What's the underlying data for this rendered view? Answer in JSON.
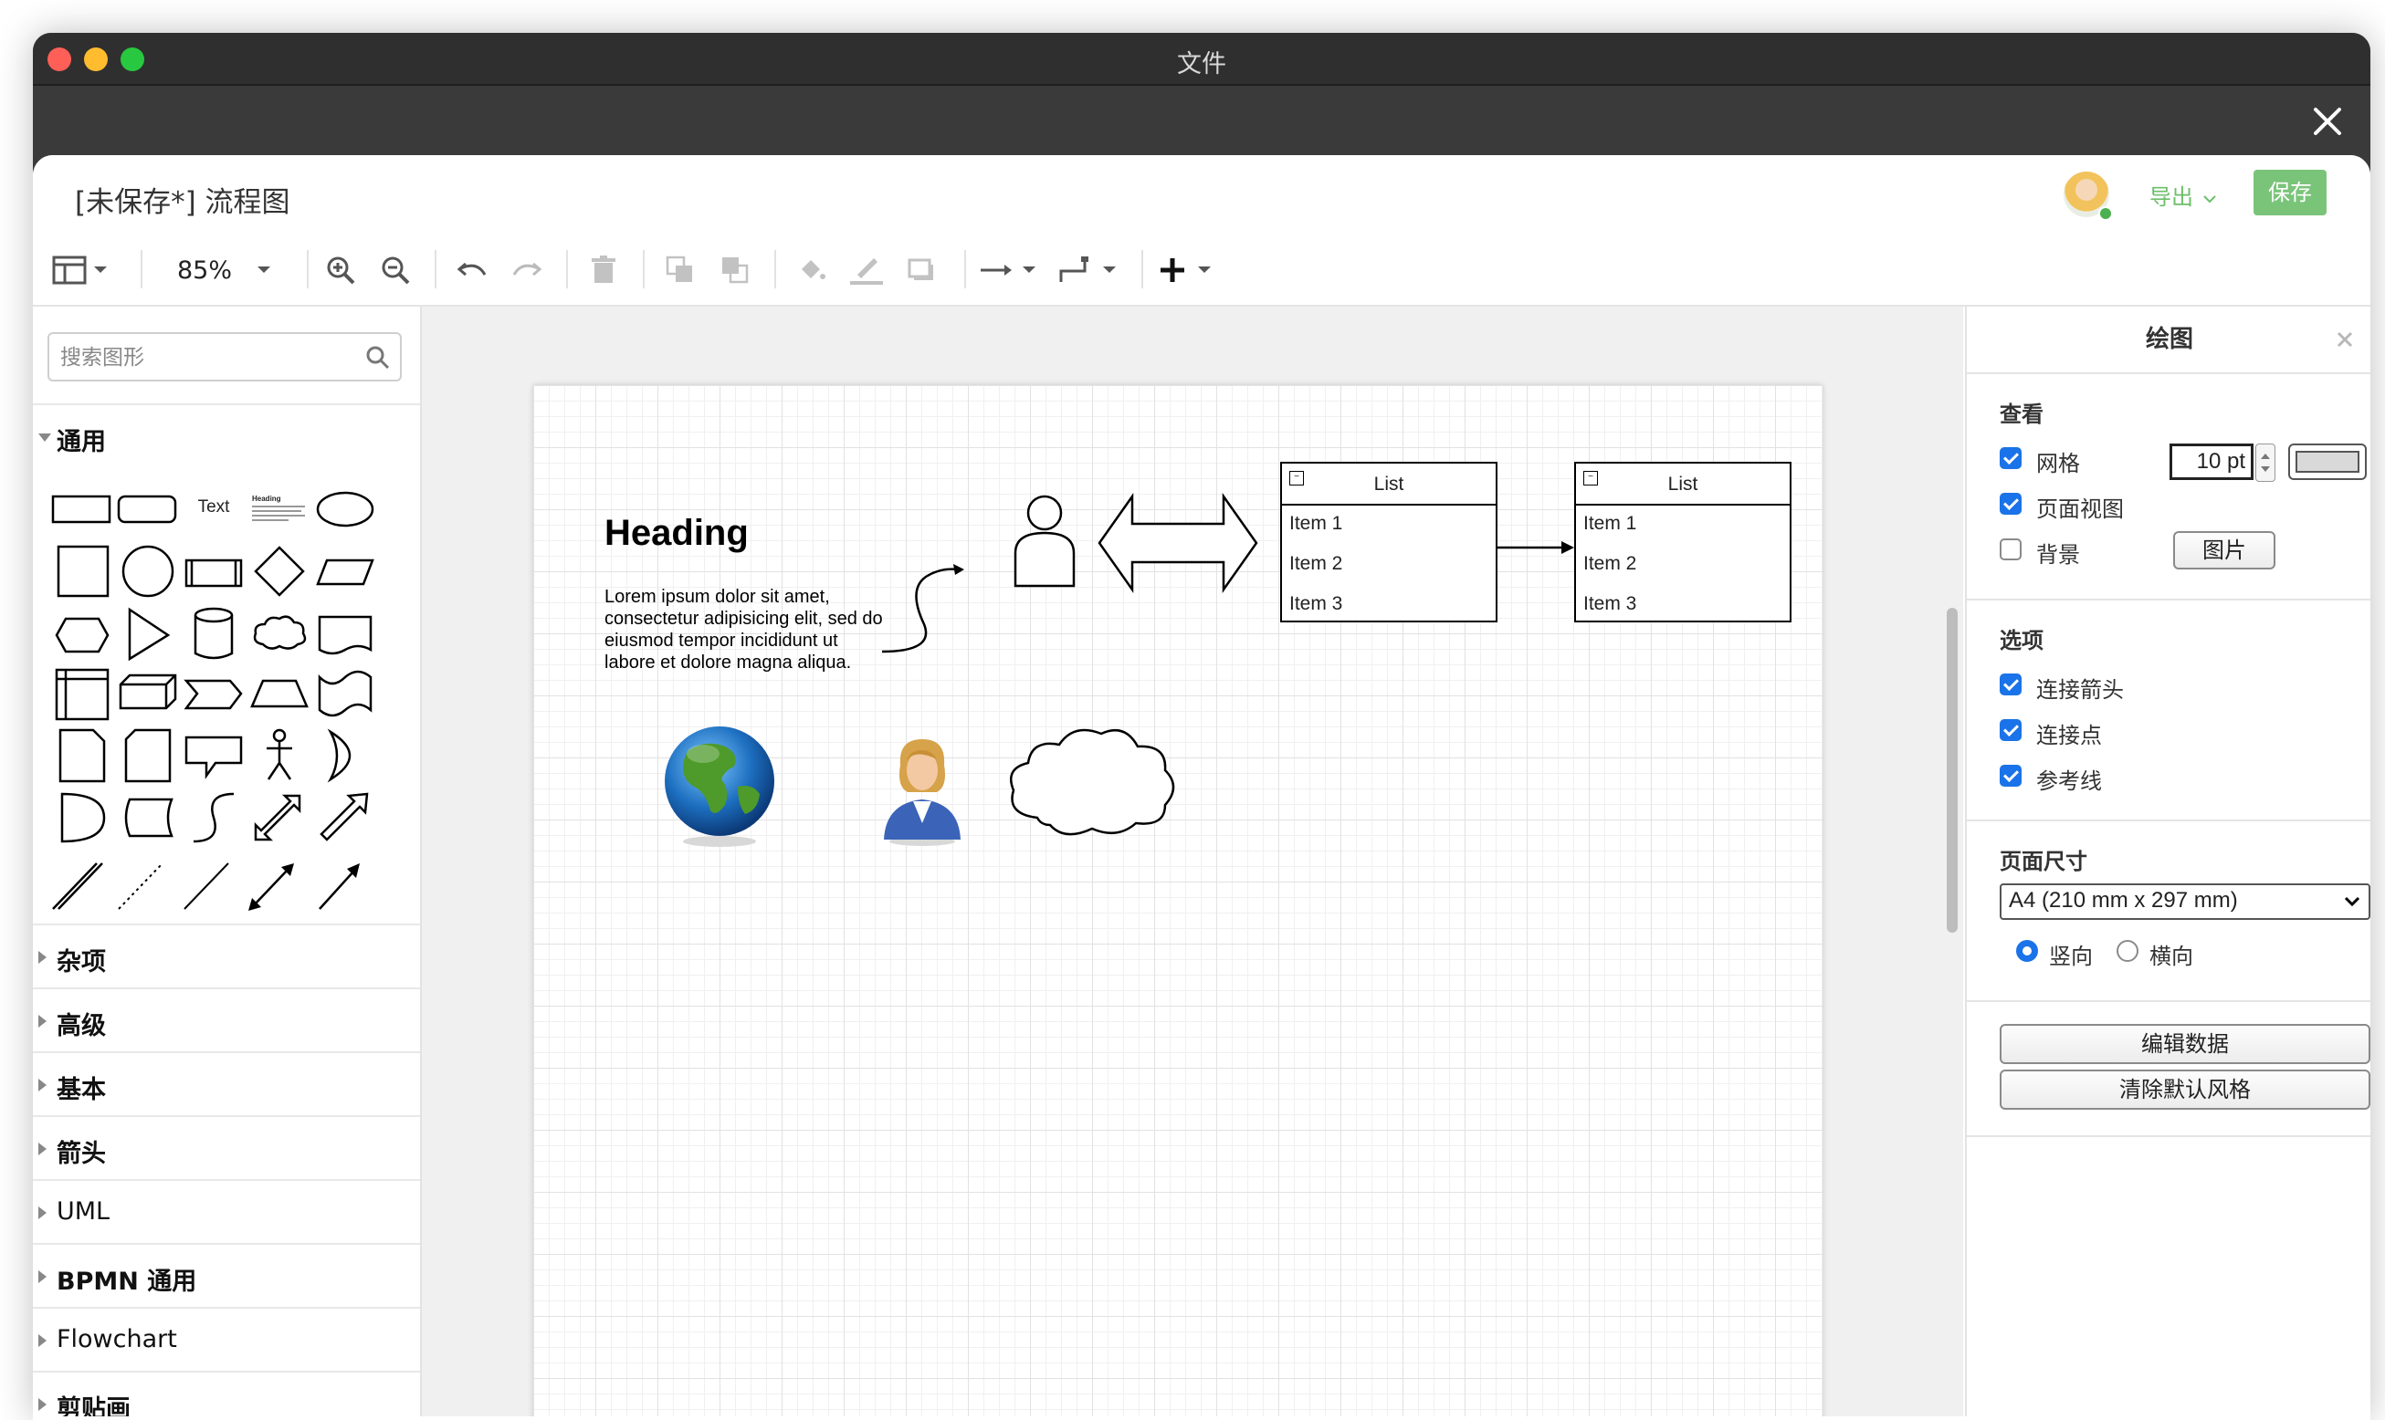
{
  "window": {
    "title": "文件"
  },
  "app": {
    "doc_title": "[未保存*]  流程图",
    "export_label": "导出",
    "save_label": "保存"
  },
  "toolbar": {
    "zoom": "85%"
  },
  "sidebar": {
    "search_placeholder": "搜索图形",
    "sections": [
      {
        "label": "通用",
        "expanded": true
      },
      {
        "label": "杂项"
      },
      {
        "label": "高级"
      },
      {
        "label": "基本"
      },
      {
        "label": "箭头"
      },
      {
        "label": "UML"
      },
      {
        "label": "BPMN 通用"
      },
      {
        "label": "Flowchart"
      },
      {
        "label": "剪贴画"
      }
    ],
    "shape_text_label": "Text",
    "shape_heading_label": "Heading"
  },
  "canvas": {
    "heading": "Heading",
    "lorem": "Lorem ipsum dolor sit amet, consectetur adipisicing elit, sed do eiusmod tempor incididunt ut labore et dolore magna aliqua.",
    "lists": [
      {
        "title": "List",
        "items": [
          "Item 1",
          "Item 2",
          "Item 3"
        ]
      },
      {
        "title": "List",
        "items": [
          "Item 1",
          "Item 2",
          "Item 3"
        ]
      }
    ]
  },
  "panel": {
    "title": "绘图",
    "view_title": "查看",
    "grid_label": "网格",
    "grid_checked": true,
    "grid_size": "10 pt",
    "pageview_label": "页面视图",
    "pageview_checked": true,
    "background_label": "背景",
    "background_checked": false,
    "image_button": "图片",
    "options_title": "选项",
    "connection_arrows": "连接箭头",
    "connection_points": "连接点",
    "guides": "参考线",
    "page_size_title": "页面尺寸",
    "page_size_value": "A4 (210 mm x 297 mm)",
    "portrait": "竖向",
    "landscape": "横向",
    "orientation_selected": "portrait",
    "edit_data_button": "编辑数据",
    "clear_style_button": "清除默认风格",
    "grid_color": "#d9d9d9"
  },
  "colors": {
    "accent": "#1a73e8",
    "save_green": "#7ac47a",
    "export_green": "#6cbf6a"
  }
}
